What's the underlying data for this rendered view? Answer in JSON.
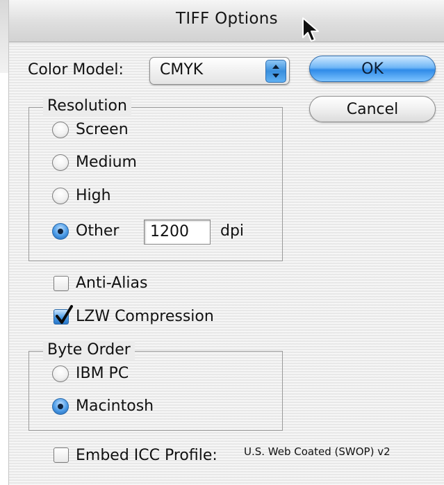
{
  "window": {
    "title": "TIFF Options"
  },
  "color_model": {
    "label": "Color Model:",
    "selected": "CMYK"
  },
  "buttons": {
    "ok": "OK",
    "cancel": "Cancel"
  },
  "resolution": {
    "title": "Resolution",
    "options": [
      {
        "label": "Screen",
        "selected": false
      },
      {
        "label": "Medium",
        "selected": false
      },
      {
        "label": "High",
        "selected": false
      },
      {
        "label": "Other",
        "selected": true
      }
    ],
    "other_value": "1200",
    "unit": "dpi"
  },
  "anti_alias": {
    "label": "Anti-Alias",
    "checked": false
  },
  "lzw_compression": {
    "label": "LZW Compression",
    "checked": true
  },
  "byte_order": {
    "title": "Byte Order",
    "options": [
      {
        "label": "IBM PC",
        "selected": false
      },
      {
        "label": "Macintosh",
        "selected": true
      }
    ]
  },
  "embed_icc": {
    "label": "Embed ICC Profile:",
    "checked": false,
    "profile": "U.S. Web Coated (SWOP) v2"
  },
  "colors": {
    "accent": "#3a8fdd",
    "dialog_bg": "#ececec"
  },
  "icons": {
    "cursor": "arrow-cursor-icon",
    "select_arrows": "up-down-arrows-icon"
  }
}
